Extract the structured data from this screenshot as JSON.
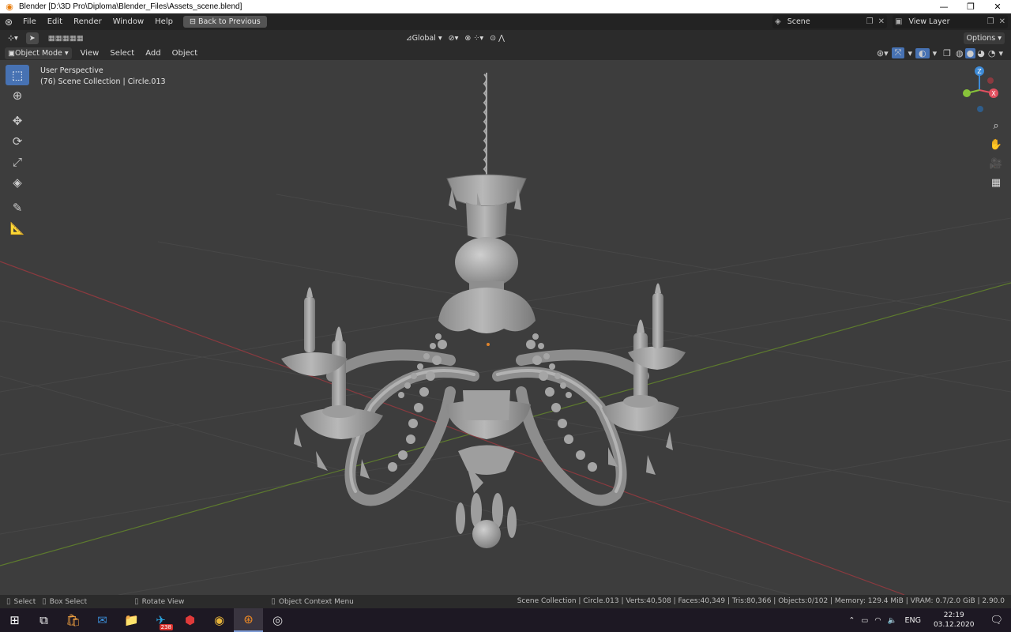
{
  "window": {
    "title": "Blender [D:\\3D Pro\\Diploma\\Blender_Files\\Assets_scene.blend]",
    "controls": [
      "—",
      "❐",
      "✕"
    ]
  },
  "topbar": {
    "menus": [
      "File",
      "Edit",
      "Render",
      "Window",
      "Help"
    ],
    "back_button": "Back to Previous",
    "scene": "Scene",
    "view_layer": "View Layer"
  },
  "header": {
    "orientation": "Global",
    "options": "Options",
    "mode": "Object Mode",
    "menus": [
      "View",
      "Select",
      "Add",
      "Object"
    ]
  },
  "viewport": {
    "perspective": "User Perspective",
    "collection": "(76) Scene Collection | Circle.013",
    "gizmo_axes": [
      "Z",
      "X"
    ]
  },
  "statusbar": {
    "select": "Select",
    "box_select": "Box Select",
    "rotate_view": "Rotate View",
    "context_menu": "Object Context Menu",
    "stats": "Scene Collection | Circle.013 | Verts:40,508 | Faces:40,349 | Tris:80,366 | Objects:0/102 | Memory: 129.4 MiB | VRAM: 0.7/2.0 GiB | 2.90.0"
  },
  "taskbar": {
    "badge": "238",
    "language": "ENG",
    "time": "22:19",
    "date": "03.12.2020"
  },
  "colors": {
    "accent": "#4772b3",
    "x_axis": "#e2505f",
    "y_axis": "#88c43a",
    "z_axis": "#3d8ad6",
    "viewport_bg": "#3d3d3d"
  }
}
